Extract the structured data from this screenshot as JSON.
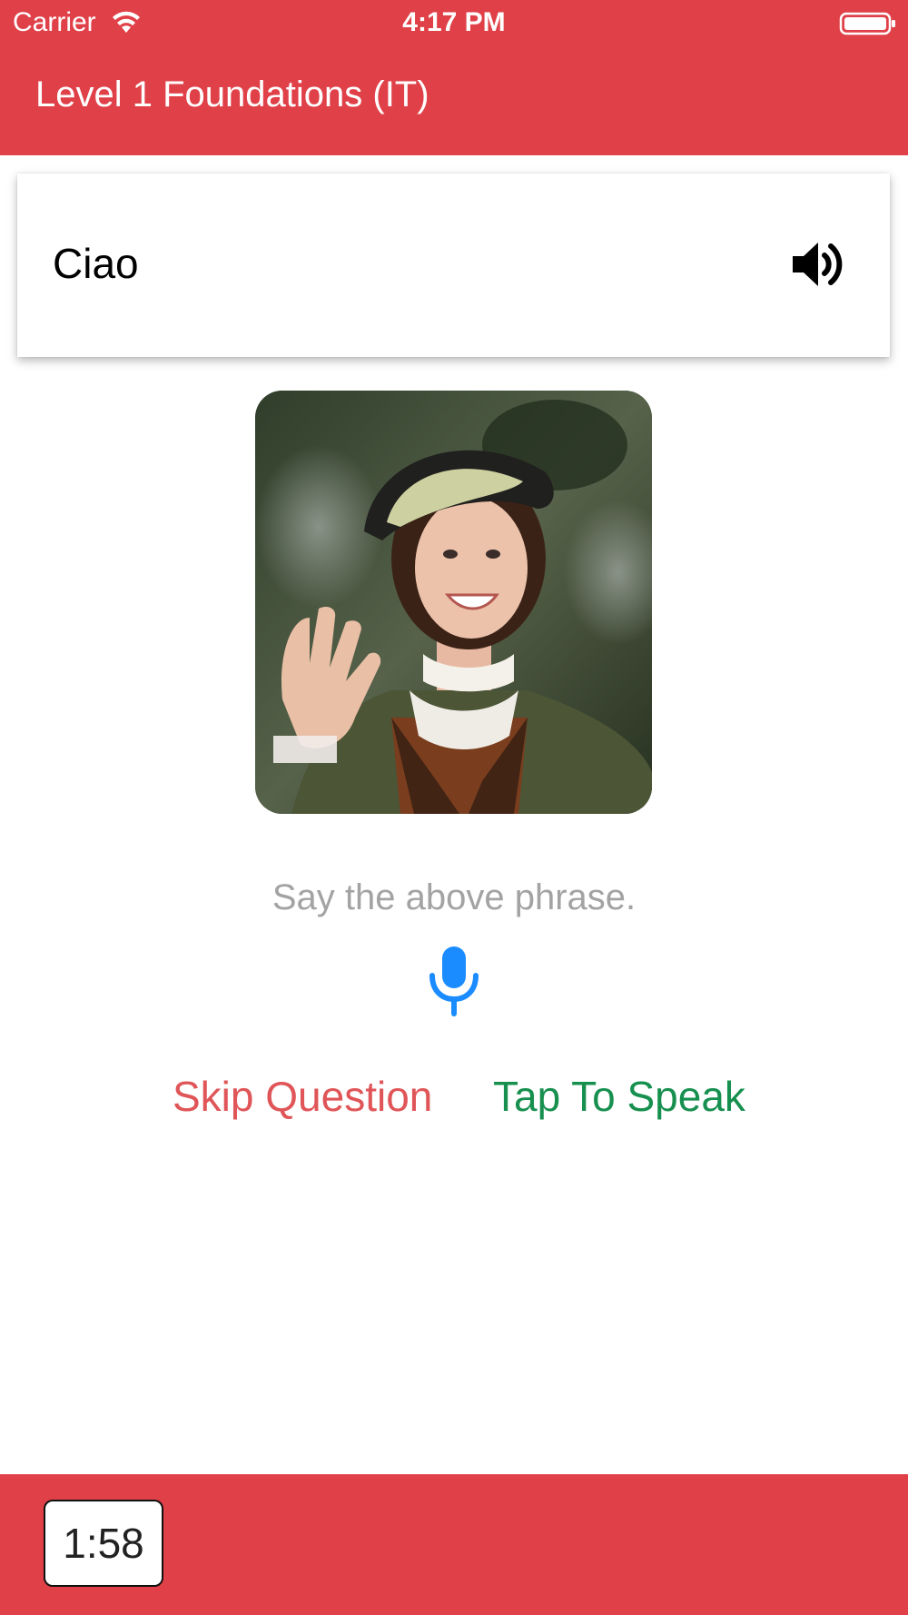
{
  "status_bar": {
    "carrier": "Carrier",
    "time": "4:17 PM",
    "wifi_icon": "wifi-icon",
    "battery_icon": "battery-icon"
  },
  "nav": {
    "title": "Level 1 Foundations (IT)"
  },
  "phrase_card": {
    "phrase": "Ciao",
    "speaker_icon": "speaker-icon"
  },
  "photo": {
    "alt": "woman-waving-photo"
  },
  "prompt": {
    "instruction": "Say the above phrase.",
    "mic_icon": "microphone-icon"
  },
  "actions": {
    "skip_label": "Skip Question",
    "speak_label": "Tap To Speak"
  },
  "footer": {
    "timer": "1:58"
  },
  "colors": {
    "brand_red": "#e04048",
    "skip_red": "#e05558",
    "speak_green": "#17904f",
    "mic_blue": "#1a8cff",
    "instruction_gray": "#a3a3a3"
  }
}
